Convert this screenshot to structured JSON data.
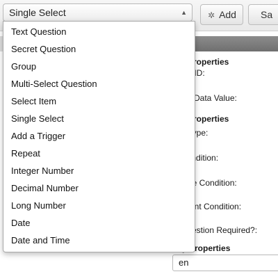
{
  "toolbar": {
    "select_value": "Single Select",
    "add_label": "Add",
    "save_label": "Sa"
  },
  "menu": {
    "items": [
      "Text Question",
      "Secret Question",
      "Group",
      "Multi-Select Question",
      "Select Item",
      "Single Select",
      "Add a Trigger",
      "Repeat",
      "Integer Number",
      "Decimal Number",
      "Long Number",
      "Date",
      "Date and Time"
    ]
  },
  "properties": {
    "heading_1": "Properties",
    "question_id": "ion ID:",
    "default_value": "ult Data Value:",
    "heading_2": "Properties",
    "type": "Type:",
    "condition": "Condition:",
    "relevant_condition": "late Condition:",
    "constraint_condition": "traint Condition:",
    "required": "Question Required?:",
    "heading_3": "y Properties",
    "language_value": "en"
  }
}
